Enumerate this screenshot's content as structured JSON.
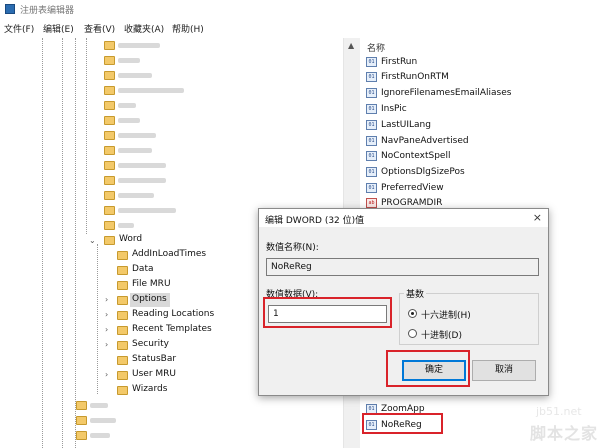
{
  "window": {
    "title": "注册表编辑器"
  },
  "menu": {
    "file": "文件(F)",
    "edit": "编辑(E)",
    "view": "查看(V)",
    "favorites": "收藏夹(A)",
    "help": "帮助(H)"
  },
  "tree": {
    "word_label": "Word",
    "word_children": [
      "AddInLoadTimes",
      "Data",
      "File MRU",
      "Options",
      "Reading Locations",
      "Recent Templates",
      "Security",
      "StatusBar",
      "User MRU",
      "Wizards"
    ]
  },
  "values_panel": {
    "header": "名称",
    "items": [
      {
        "name": "FirstRun",
        "type": "reg_dword"
      },
      {
        "name": "FirstRunOnRTM",
        "type": "reg_dword"
      },
      {
        "name": "IgnoreFilenamesEmailAliases",
        "type": "reg_dword"
      },
      {
        "name": "InsPic",
        "type": "reg_dword"
      },
      {
        "name": "LastUILang",
        "type": "reg_dword"
      },
      {
        "name": "NavPaneAdvertised",
        "type": "reg_dword"
      },
      {
        "name": "NoContextSpell",
        "type": "reg_dword"
      },
      {
        "name": "OptionsDlgSizePos",
        "type": "reg_dword"
      },
      {
        "name": "PreferredView",
        "type": "reg_dword"
      },
      {
        "name": "PROGRAMDIR",
        "type": "reg_sz"
      }
    ],
    "bottom_items": [
      {
        "name": "ZoomApp",
        "type": "reg_dword"
      },
      {
        "name": "NoReReg",
        "type": "reg_dword"
      }
    ]
  },
  "dialog": {
    "title": "编辑 DWORD (32 位)值",
    "name_label": "数值名称(N):",
    "name_value": "NoReReg",
    "data_label": "数值数据(V):",
    "data_value": "1",
    "base_label": "基数",
    "hex_label": "十六进制(H)",
    "dec_label": "十进制(D)",
    "ok_label": "确定",
    "cancel_label": "取消",
    "close_glyph": "×"
  },
  "watermark": {
    "line1": "jb51.net",
    "line2": "脚本之家"
  },
  "colors": {
    "highlight": "#d9232a",
    "accent": "#0078d7",
    "folder": "#f3c969"
  }
}
